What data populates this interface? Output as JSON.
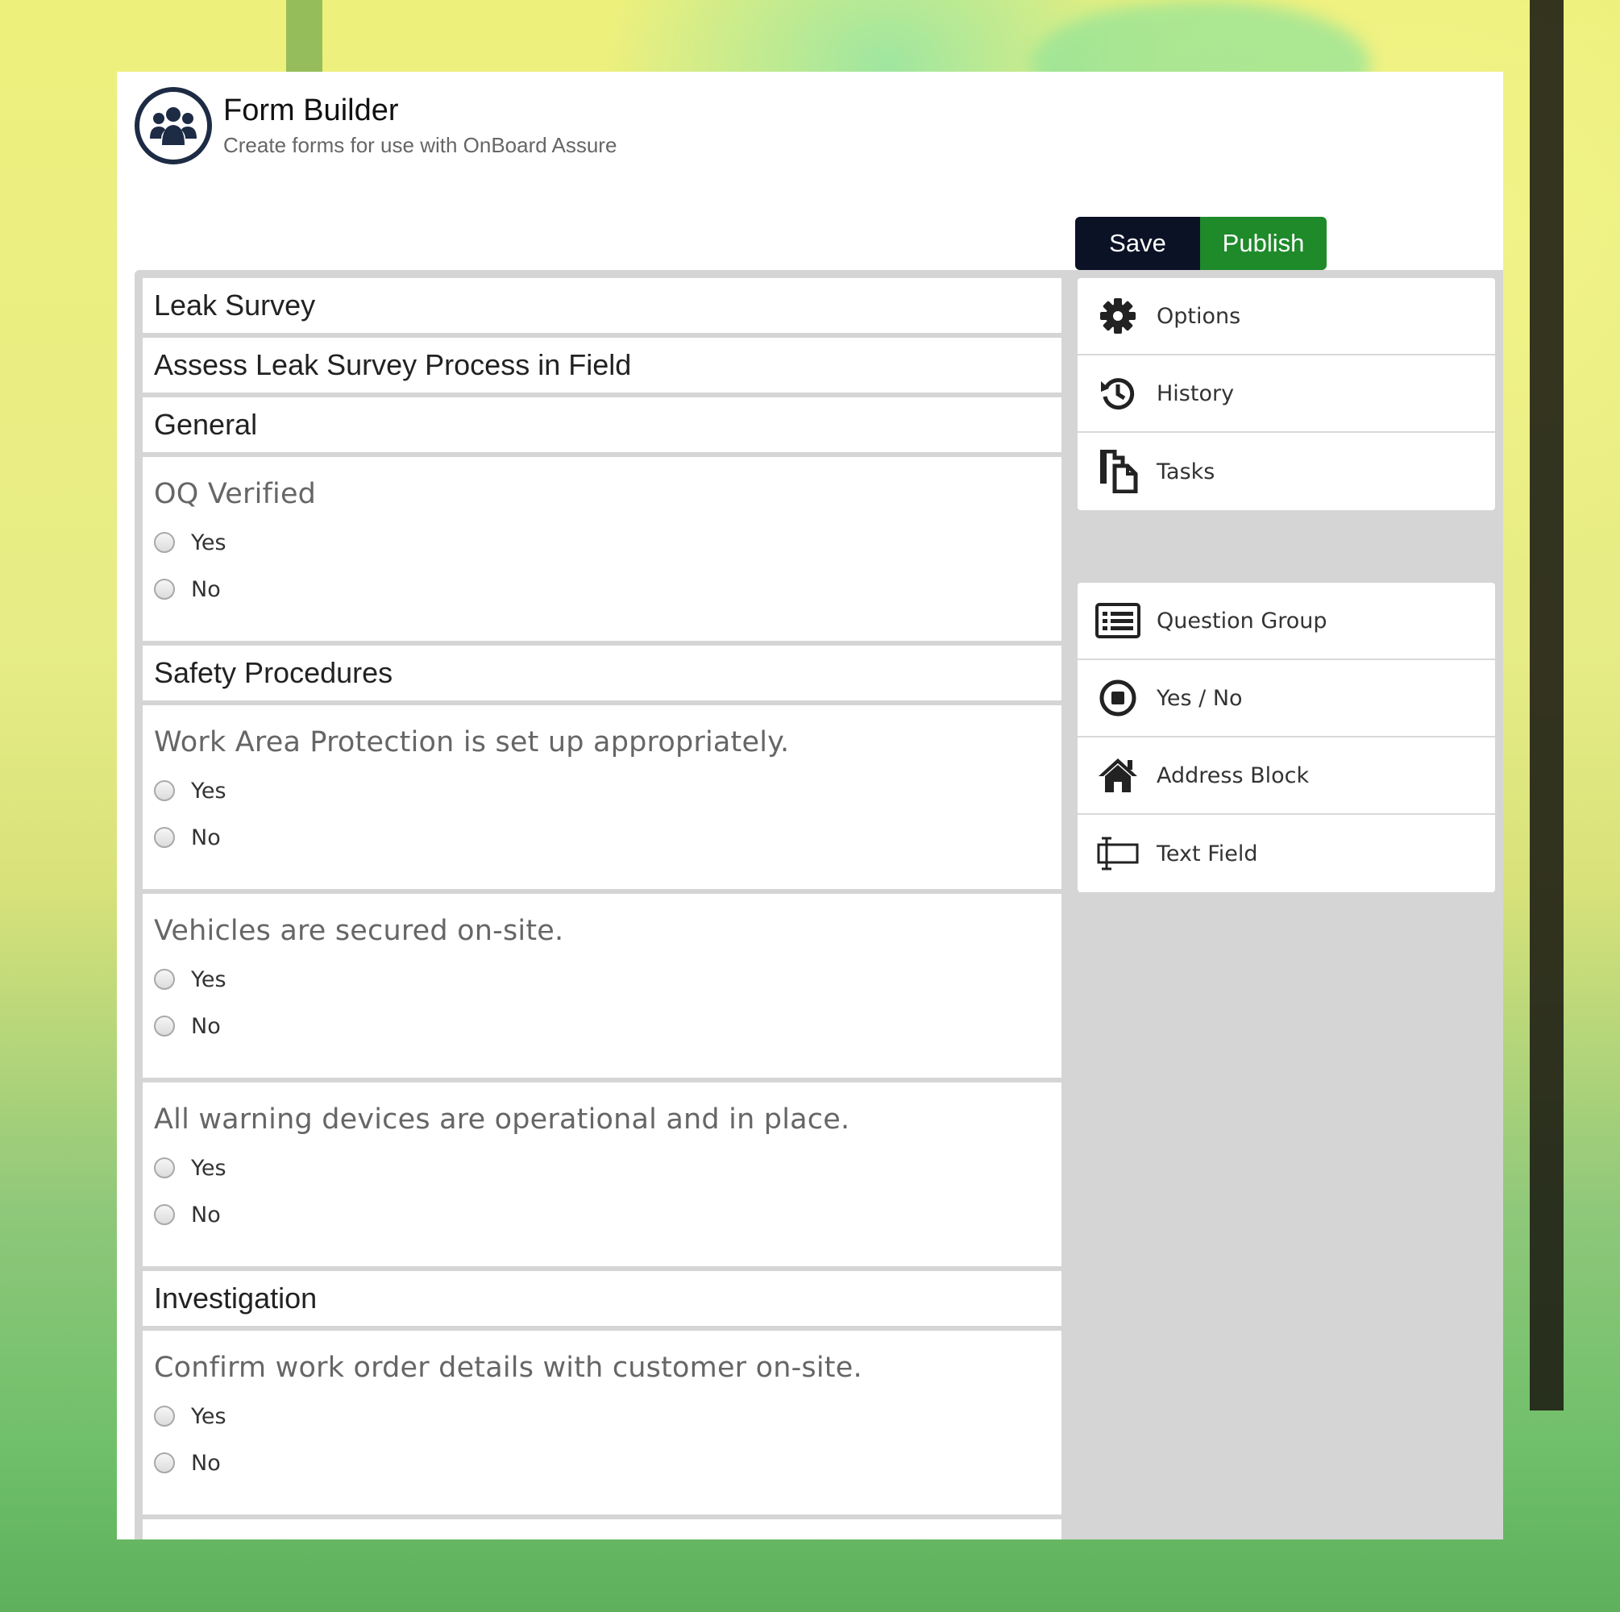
{
  "app": {
    "title": "Form Builder",
    "subtitle": "Create forms for use with OnBoard Assure",
    "logo_icon": "people-group-icon"
  },
  "toolbar": {
    "save_label": "Save",
    "publish_label": "Publish",
    "save_color": "#0b1226",
    "publish_color": "#1e8a2a"
  },
  "form": {
    "title": "Leak Survey",
    "description": "Assess Leak Survey Process in Field",
    "sections": [
      {
        "heading": "General",
        "questions": [
          {
            "label": "OQ Verified",
            "options": [
              "Yes",
              "No"
            ]
          }
        ]
      },
      {
        "heading": "Safety Procedures",
        "questions": [
          {
            "label": "Work Area Protection is set up appropriately.",
            "options": [
              "Yes",
              "No"
            ]
          },
          {
            "label": "Vehicles are secured on-site.",
            "options": [
              "Yes",
              "No"
            ]
          },
          {
            "label": "All warning devices are operational and in place.",
            "options": [
              "Yes",
              "No"
            ]
          }
        ]
      },
      {
        "heading": "Investigation",
        "questions": [
          {
            "label": "Confirm work order details with customer on-site.",
            "options": [
              "Yes",
              "No"
            ]
          }
        ]
      }
    ]
  },
  "sidebar": {
    "menu": [
      {
        "label": "Options",
        "icon": "gear-icon"
      },
      {
        "label": "History",
        "icon": "history-icon"
      },
      {
        "label": "Tasks",
        "icon": "tasks-icon"
      }
    ],
    "components": [
      {
        "label": "Question Group",
        "icon": "list-icon"
      },
      {
        "label": "Yes / No",
        "icon": "radio-stop-icon"
      },
      {
        "label": "Address Block",
        "icon": "home-icon"
      },
      {
        "label": "Text Field",
        "icon": "text-field-icon"
      }
    ]
  }
}
